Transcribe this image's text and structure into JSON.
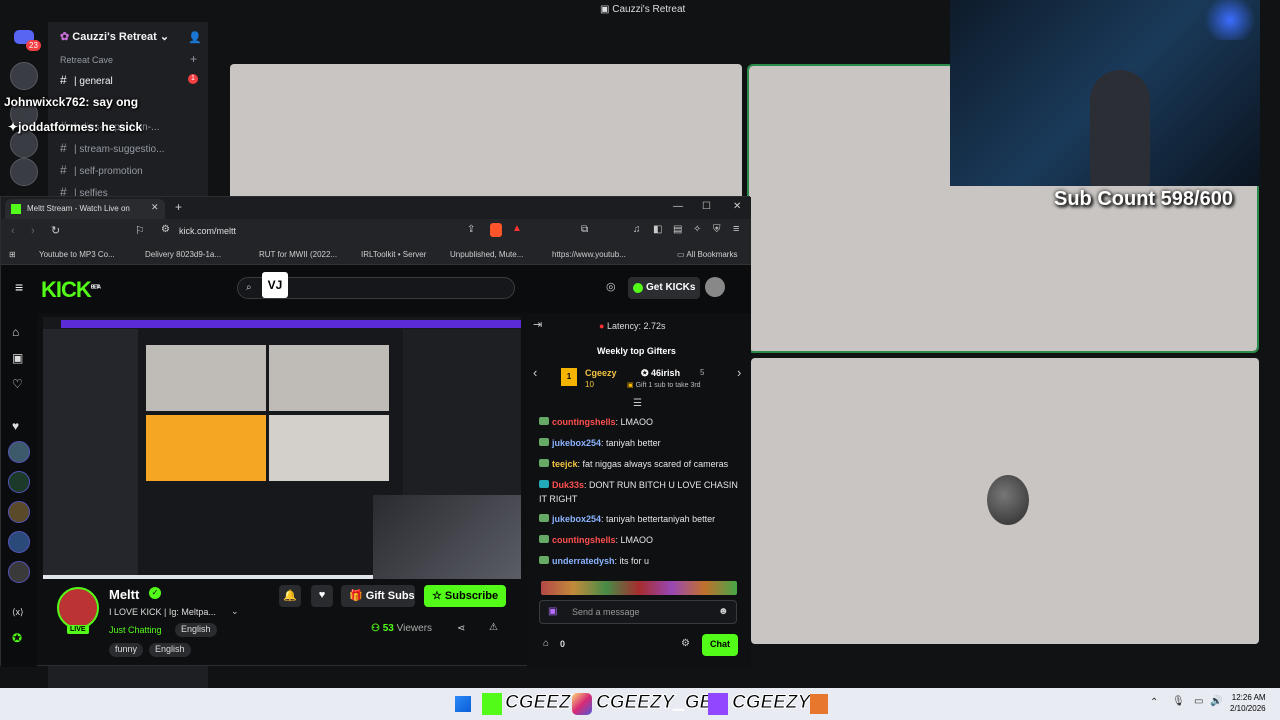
{
  "discord": {
    "window_title": "Cauzzi's Retreat",
    "server_name": "Cauzzi's Retreat",
    "category": "Retreat Cave",
    "notification_count": "23",
    "channels": [
      {
        "name": "| general",
        "unread": "1"
      },
      {
        "name": "| updates",
        "unread": ""
      },
      {
        "name": "| clips-to-post-on-...",
        "unread": ""
      },
      {
        "name": "| stream-suggestio...",
        "unread": ""
      },
      {
        "name": "| self-promotion",
        "unread": ""
      },
      {
        "name": "| selfies",
        "unread": ""
      }
    ],
    "server_badges": [
      "1",
      "1",
      "3",
      "2"
    ]
  },
  "overlay": {
    "chat": [
      {
        "user": "Johnwixck762",
        "text": "say ong"
      },
      {
        "user": "joddatformes",
        "text": "he sick"
      }
    ],
    "sub_count": "Sub Count 598/600"
  },
  "browser": {
    "tab_title": "Meltt Stream - Watch Live on",
    "url": "kick.com/meltt",
    "bookmarks": [
      "Youtube to MP3 Co...",
      "Delivery 8023d9-1a...",
      "RUT for MWII (2022...",
      "IRLToolkit • Server",
      "Unpublished, Mute...",
      "https://www.youtub..."
    ],
    "all_bookmarks": "All Bookmarks"
  },
  "kick": {
    "logo": "KICK",
    "logo_tag": "BETA",
    "get_kicks": "Get KICKs",
    "streamer": {
      "name": "Meltt",
      "title": "I LOVE KICK | Ig: Meltpa...",
      "category": "Just Chatting",
      "language": "English",
      "tags": [
        "funny",
        "English"
      ],
      "live_badge": "LIVE",
      "viewers": "53",
      "viewers_label": "Viewers"
    },
    "buttons": {
      "gift_subs": "Gift Subs",
      "subscribe": "Subscribe"
    },
    "chat": {
      "latency": "Latency: 2.72s",
      "gifters_title": "Weekly top Gifters",
      "gifter1": {
        "name": "Cgeezy",
        "count": "10"
      },
      "gifter2": {
        "name": "46irish",
        "count": "5",
        "note": "Gift 1 sub to take 3rd"
      },
      "messages": [
        {
          "user": "countingshells",
          "text": ": LMAOO",
          "color": "red"
        },
        {
          "user": "jukebox254",
          "text": ": taniyah better",
          "color": "blue"
        },
        {
          "user": "teejck",
          "text": ": fat niggas always scared of cameras",
          "color": "yellow"
        },
        {
          "user": "Duk33s",
          "text": ": DONT RUN BITCH U LOVE CHASIN IT RIGHT",
          "color": "red"
        },
        {
          "user": "jukebox254",
          "text": ": taniyah bettertaniyah better",
          "color": "blue"
        },
        {
          "user": "countingshells",
          "text": ": LMAOO",
          "color": "red"
        },
        {
          "user": "underratedysh",
          "text": ": its for u",
          "color": "blue"
        }
      ],
      "input_placeholder": "Send a message",
      "points": "0",
      "send_label": "Chat"
    }
  },
  "taskbar": {
    "handles": [
      "CGEEZY",
      "CGEEZY_GBC",
      "CGEEZY"
    ],
    "time": "12:26 AM",
    "date": "2/10/2026"
  },
  "colors": {
    "kick_green": "#53fc18",
    "discord_bg": "#1e1f22",
    "subscribe_bg": "#53fc18"
  }
}
